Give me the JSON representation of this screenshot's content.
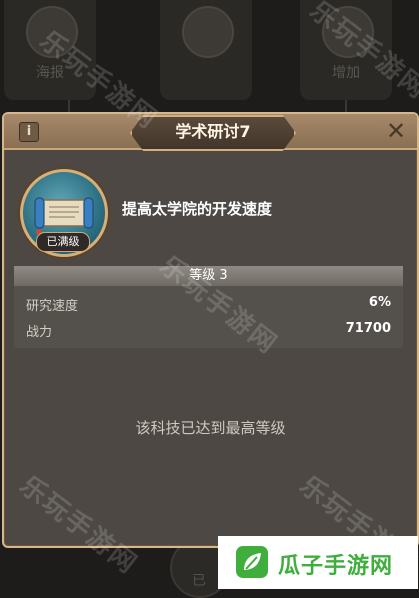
{
  "background": {
    "cards": [
      {
        "label": "海报",
        "icon": "building-icon"
      },
      {
        "label": "",
        "icon": "book-icon"
      },
      {
        "label": "增加",
        "icon": "gear-icon"
      }
    ],
    "bottom_label": "已"
  },
  "dialog": {
    "title": "学术研讨7",
    "info_icon": "i",
    "close_icon": "✕",
    "tech": {
      "icon": "scroll-icon",
      "badge": "已满级",
      "description": "提高太学院的开发速度"
    },
    "level": "等级 3",
    "stats": [
      {
        "label": "研究速度",
        "value": "6%"
      },
      {
        "label": "战力",
        "value": "71700"
      }
    ],
    "max_message": "该科技已达到最高等级"
  },
  "watermarks": [
    "乐玩手游网",
    "乐玩手游网",
    "乐玩手游网",
    "乐玩手游网",
    "乐玩手游网"
  ],
  "site_logo": {
    "text": "瓜子手游网",
    "color": "#3fae3c"
  }
}
